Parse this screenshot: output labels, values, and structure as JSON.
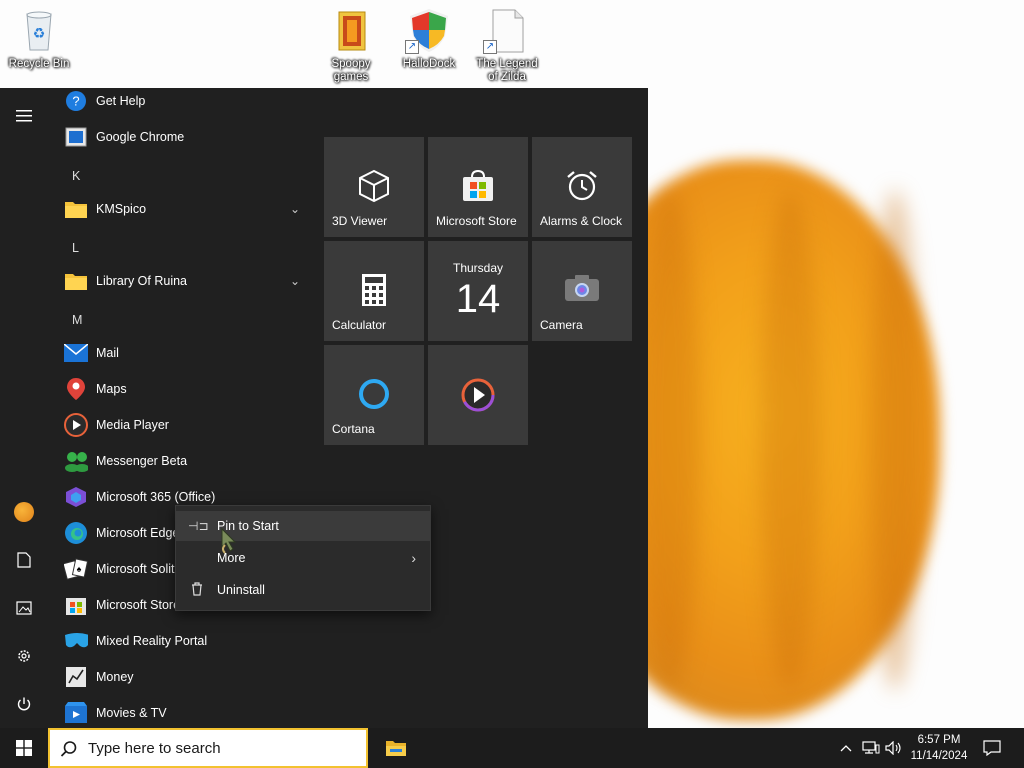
{
  "desktop": {
    "icons": [
      {
        "label": "Recycle Bin",
        "icon": "recycle-bin-icon"
      },
      {
        "label": "Spoopy games",
        "icon": "folder-icon"
      },
      {
        "label": "HalloDock",
        "icon": "shield-icon"
      },
      {
        "label": "The Legend of Zilda",
        "icon": "file-icon"
      }
    ]
  },
  "start_menu": {
    "rail": {
      "menu": "hamburger-icon",
      "items": [
        "user-avatar",
        "documents-icon",
        "pictures-icon",
        "settings-icon",
        "power-icon"
      ]
    },
    "apps": [
      {
        "label": "Get Help",
        "icon": "help-icon"
      },
      {
        "label": "Google Chrome",
        "icon": "chrome-icon"
      },
      {
        "letter": "K"
      },
      {
        "label": "KMSpico",
        "icon": "folder-icon",
        "expandable": true
      },
      {
        "letter": "L"
      },
      {
        "label": "Library Of Ruina",
        "icon": "folder-icon",
        "expandable": true
      },
      {
        "letter": "M"
      },
      {
        "label": "Mail",
        "icon": "mail-icon"
      },
      {
        "label": "Maps",
        "icon": "maps-icon"
      },
      {
        "label": "Media Player",
        "icon": "media-player-icon"
      },
      {
        "label": "Messenger Beta",
        "icon": "messenger-icon"
      },
      {
        "label": "Microsoft 365 (Office)",
        "icon": "office-icon"
      },
      {
        "label": "Microsoft Edge",
        "icon": "edge-icon"
      },
      {
        "label": "Microsoft Solitaire Collection",
        "icon": "solitaire-icon"
      },
      {
        "label": "Microsoft Store",
        "icon": "store-icon"
      },
      {
        "label": "Mixed Reality Portal",
        "icon": "mixed-reality-icon"
      },
      {
        "label": "Money",
        "icon": "money-icon"
      },
      {
        "label": "Movies & TV",
        "icon": "movies-icon"
      }
    ],
    "tiles": [
      {
        "label": "3D Viewer",
        "icon": "cube-icon"
      },
      {
        "label": "Microsoft Store",
        "icon": "store-icon"
      },
      {
        "label": "Alarms & Clock",
        "icon": "alarm-clock-icon"
      },
      {
        "label": "Calculator",
        "icon": "calculator-icon"
      },
      {
        "label": "",
        "icon": "calendar-icon",
        "day": "Thursday",
        "date": "14"
      },
      {
        "label": "Camera",
        "icon": "camera-icon"
      },
      {
        "label": "Cortana",
        "icon": "cortana-icon"
      },
      {
        "label": "",
        "icon": "media-player-icon"
      }
    ]
  },
  "context_menu": {
    "items": [
      {
        "label": "Pin to Start",
        "icon": "pin-icon"
      },
      {
        "label": "More",
        "icon": "",
        "submenu": true
      },
      {
        "label": "Uninstall",
        "icon": "trash-icon"
      }
    ]
  },
  "taskbar": {
    "search_placeholder": "Type here to search",
    "pinned": [
      "file-explorer-icon"
    ],
    "tray": [
      "chevron-up-icon",
      "network-icon",
      "volume-icon"
    ],
    "time": "6:57 PM",
    "date": "11/14/2024",
    "notifications": "notification-icon"
  },
  "colors": {
    "start_bg": "#202020",
    "tile_bg": "#3a3a3a",
    "taskbar_bg": "#1c1c1c",
    "accent": "#0078d4",
    "search_border": "#f2c230"
  }
}
